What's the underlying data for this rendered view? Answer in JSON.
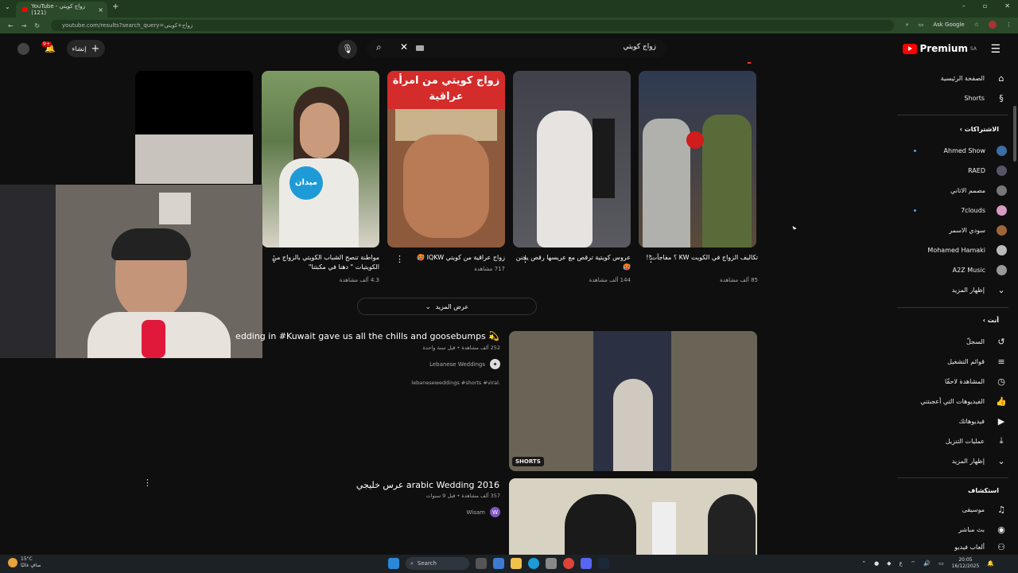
{
  "browser": {
    "tab_title": "YouTube - زواج كويتي (121)",
    "url": "youtube.com/results?search_query=زواج+كويتي",
    "ask_google": "Ask Google"
  },
  "header": {
    "logo_text": "Premium",
    "logo_region": "SA",
    "search_query": "زواج كويتي",
    "create_label": "إنشاء",
    "notif_count": "9+"
  },
  "sidebar": {
    "home": "الصفحة الرئيسية",
    "shorts": "Shorts",
    "subscriptions_heading": "الاشتراكات",
    "subscriptions": [
      {
        "name": "Ahmed Show",
        "dot": true
      },
      {
        "name": "RAED",
        "dot": false
      },
      {
        "name": "مصمم الاتاني",
        "dot": false
      },
      {
        "name": "7clouds",
        "dot": true
      },
      {
        "name": "سودي الاسمر",
        "dot": false
      },
      {
        "name": "Mohamed Hamaki",
        "dot": false
      },
      {
        "name": "A2Z Music",
        "dot": false
      }
    ],
    "show_more_1": "إظهار المزيد",
    "you_heading": "أنت",
    "you_items": [
      "السجلّ",
      "قوائم التشغيل",
      "المشاهدة لاحقًا",
      "الفيديوهات التي أعجبتني",
      "فيديوهاتك",
      "عمليات التنزيل"
    ],
    "show_more_2": "إظهار المزيد",
    "explore_heading": "استكشاف",
    "explore_items": [
      "موسيقى",
      "بث مباشر",
      "ألعاب فيديو"
    ]
  },
  "shorts": [
    {
      "title": "تكاليف الزواج في الكويت KW ؟ مفاجآت!!",
      "views": "85 ألف مشاهدة"
    },
    {
      "title": "عروس كويتية ترقص مع عريسها رقص يجنن 🥵",
      "views": "144 ألف مشاهدة"
    },
    {
      "title": "زواج عراقية من كويتي IQKW 🥵",
      "views": "717 مشاهدة"
    },
    {
      "title": "مواطنة تنصح الشباب الكويتي بالزواج من الكويتيات \" دهنا في مكبتنا\"",
      "views": "4.3 ألف مشاهدة"
    }
  ],
  "short_overlay_text": [
    "زواج كويتي من امرأة",
    "عراقية"
  ],
  "short_mic_label": "ميدان",
  "show_more_label": "عرض المزيد",
  "video1": {
    "title": "edding in #Kuwait gave us all the chills and goosebumps 💫",
    "meta": "252 ألف مشاهدة • قبل سنة واحدة",
    "channel": "Lebanese Weddings",
    "desc": "lebaneseweddings #shorts #viral.",
    "badge": "SHORTS"
  },
  "video2": {
    "title": "عرس خليجي arabic Wedding 2016",
    "meta": "357 ألف مشاهدة • قبل 9 سنوات",
    "channel": "Wisam",
    "channel_initial": "W"
  },
  "taskbar": {
    "temp": "15°C",
    "weather": "صافٍ غالبًا",
    "search": "Search",
    "time": "20:05",
    "date": "16/12/2025",
    "lang": "ع"
  }
}
